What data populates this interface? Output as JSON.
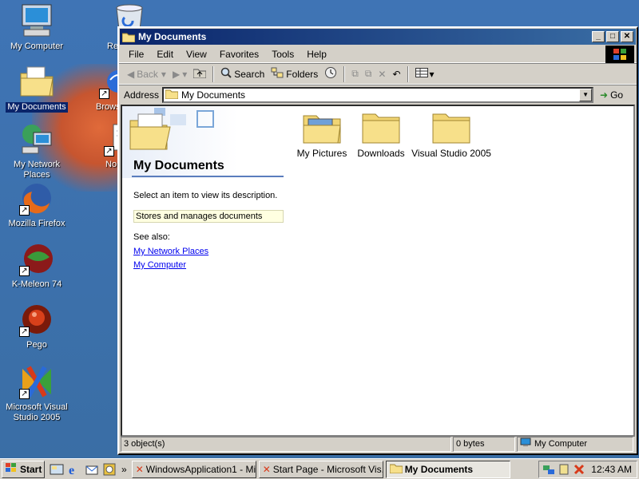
{
  "desktop": {
    "icons": [
      {
        "label": "My Computer",
        "icon": "my-computer-icon"
      },
      {
        "label": "Re",
        "icon": "recycle-bin-icon"
      },
      {
        "label": "My Documents",
        "icon": "my-documents-icon"
      },
      {
        "label": "Brows",
        "icon": "browser-shortcut-icon"
      },
      {
        "label": "My Network Places",
        "icon": "network-places-icon"
      },
      {
        "label": "No",
        "icon": "notepad-shortcut-icon"
      },
      {
        "label": "Mozilla Firefox",
        "icon": "firefox-icon"
      },
      {
        "label": "K-Meleon 74",
        "icon": "k-meleon-icon"
      },
      {
        "label": "Pego",
        "icon": "pego-icon"
      },
      {
        "label": "Microsoft Visual Studio 2005",
        "icon": "visual-studio-icon"
      }
    ]
  },
  "window": {
    "title": "My Documents",
    "menu": [
      "File",
      "Edit",
      "View",
      "Favorites",
      "Tools",
      "Help"
    ],
    "toolbar": {
      "back": "Back",
      "search": "Search",
      "folders": "Folders"
    },
    "address": {
      "label": "Address",
      "value": "My Documents",
      "go": "Go"
    },
    "left_pane": {
      "title": "My Documents",
      "hint": "Select an item to view its description.",
      "description": "Stores and manages documents",
      "see_also": "See also:",
      "links": [
        "My Network Places",
        "My Computer"
      ]
    },
    "files": [
      {
        "name": "My Pictures",
        "icon": "pictures-folder-icon"
      },
      {
        "name": "Downloads",
        "icon": "folder-icon"
      },
      {
        "name": "Visual Studio 2005",
        "icon": "folder-icon"
      }
    ],
    "status": {
      "objects": "3 object(s)",
      "size": "0 bytes",
      "zone": "My Computer"
    }
  },
  "taskbar": {
    "start": "Start",
    "tasks": [
      {
        "label": "WindowsApplication1 - Mi...",
        "active": false
      },
      {
        "label": "Start Page - Microsoft Vis...",
        "active": false
      },
      {
        "label": "My Documents",
        "active": true
      }
    ],
    "clock": "12:43 AM"
  },
  "colors": {
    "desktop": "#3a6ea5",
    "titlebar_start": "#0a246a",
    "titlebar_end": "#3a6ea5",
    "window_face": "#d4d0c8",
    "link": "#0000ee",
    "folder": "#f7e08a"
  }
}
